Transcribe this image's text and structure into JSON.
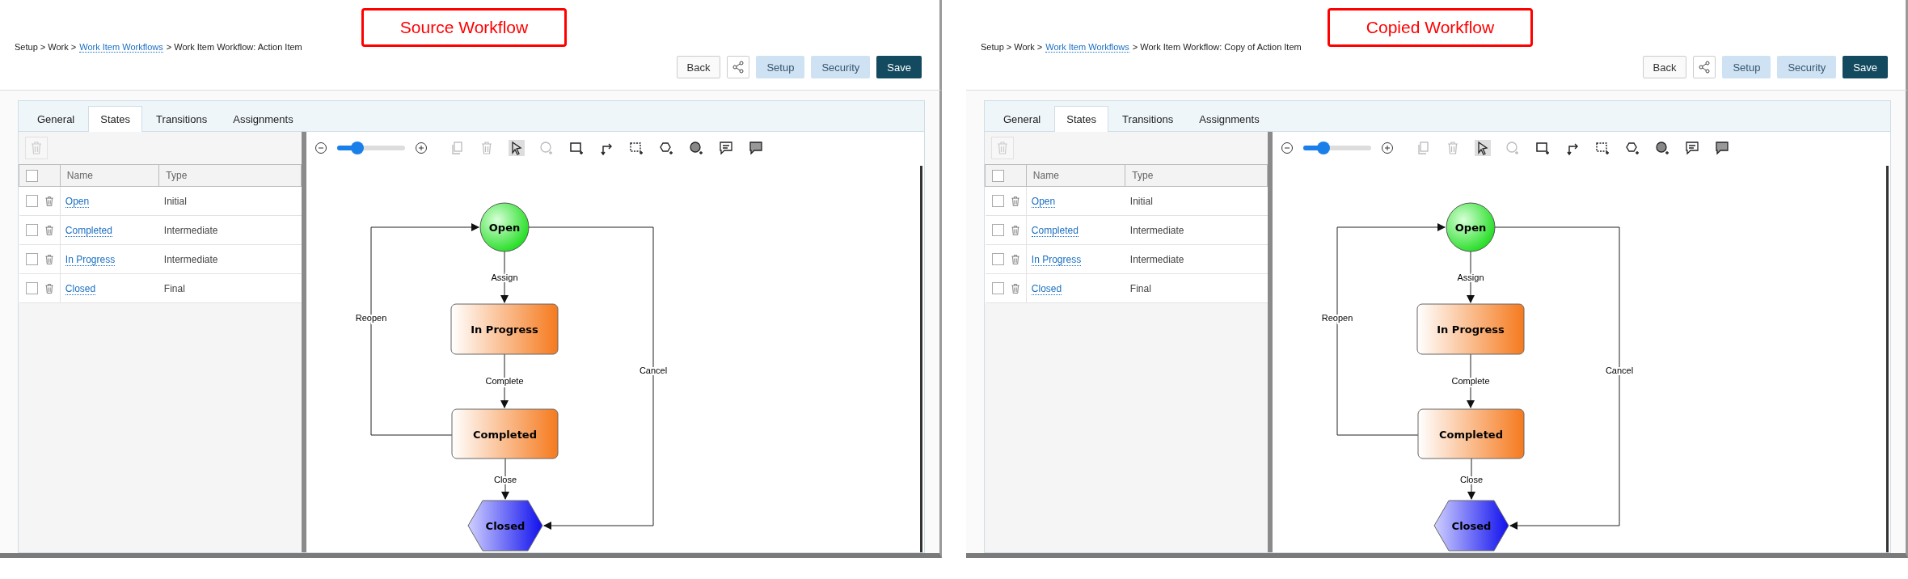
{
  "panels": [
    {
      "callout": "Source Workflow",
      "breadcrumb": [
        {
          "text": "Setup > Work >",
          "link": false
        },
        {
          "text": "Work Item Workflows",
          "link": true
        },
        {
          "text": "> Work Item Workflow: Action Item",
          "link": false
        }
      ],
      "buttons": [
        {
          "kind": "default",
          "label": "Back"
        },
        {
          "kind": "share"
        },
        {
          "kind": "secondary",
          "label": "Setup"
        },
        {
          "kind": "secondary",
          "label": "Security"
        },
        {
          "kind": "primary",
          "label": "Save"
        }
      ],
      "tabs": [
        {
          "label": "General",
          "selected": false
        },
        {
          "label": "States",
          "selected": true
        },
        {
          "label": "Transitions",
          "selected": false
        },
        {
          "label": "Assignments",
          "selected": false
        }
      ],
      "table": {
        "select_all_checked": false,
        "columns": [
          "Name",
          "Type"
        ],
        "rows": [
          {
            "name": "Open",
            "type": "Initial",
            "checked": false
          },
          {
            "name": "Completed",
            "type": "Intermediate",
            "checked": false
          },
          {
            "name": "In Progress",
            "type": "Intermediate",
            "checked": false
          },
          {
            "name": "Closed",
            "type": "Final",
            "checked": false
          }
        ]
      },
      "zoom": {
        "level": 0.3
      },
      "toolbar": [
        {
          "kind": "copy",
          "disabled": true,
          "selected": false
        },
        {
          "kind": "delete",
          "disabled": true,
          "selected": false
        },
        {
          "kind": "pointer",
          "disabled": false,
          "selected": true
        },
        {
          "kind": "add-circle",
          "disabled": true,
          "selected": false
        },
        {
          "kind": "add-rect",
          "disabled": false,
          "selected": false
        },
        {
          "kind": "connector",
          "disabled": false,
          "selected": false
        },
        {
          "kind": "add-dashed-rect",
          "disabled": false,
          "selected": false
        },
        {
          "kind": "add-hexagon",
          "disabled": false,
          "selected": false
        },
        {
          "kind": "add-filled-circle",
          "disabled": false,
          "selected": false
        },
        {
          "kind": "comment",
          "disabled": false,
          "selected": false
        },
        {
          "kind": "filled-comment",
          "disabled": false,
          "selected": false
        }
      ],
      "diagram": {
        "nodes": [
          {
            "label": "Open",
            "kind": "initial"
          },
          {
            "label": "In Progress",
            "kind": "intermediate"
          },
          {
            "label": "Completed",
            "kind": "intermediate"
          },
          {
            "label": "Closed",
            "kind": "final"
          }
        ],
        "edges": [
          {
            "label": "Assign"
          },
          {
            "label": "Complete"
          },
          {
            "label": "Close"
          },
          {
            "label": "Reopen"
          },
          {
            "label": "Cancel"
          }
        ]
      }
    },
    {
      "callout": "Copied Workflow",
      "breadcrumb": [
        {
          "text": "Setup > Work >",
          "link": false
        },
        {
          "text": "Work Item Workflows",
          "link": true
        },
        {
          "text": "> Work Item Workflow: Copy of Action Item",
          "link": false
        }
      ],
      "buttons": [
        {
          "kind": "default",
          "label": "Back"
        },
        {
          "kind": "share"
        },
        {
          "kind": "secondary",
          "label": "Setup"
        },
        {
          "kind": "secondary",
          "label": "Security"
        },
        {
          "kind": "primary",
          "label": "Save"
        }
      ],
      "tabs": [
        {
          "label": "General",
          "selected": false
        },
        {
          "label": "States",
          "selected": true
        },
        {
          "label": "Transitions",
          "selected": false
        },
        {
          "label": "Assignments",
          "selected": false
        }
      ],
      "table": {
        "select_all_checked": false,
        "columns": [
          "Name",
          "Type"
        ],
        "rows": [
          {
            "name": "Open",
            "type": "Initial",
            "checked": false
          },
          {
            "name": "Completed",
            "type": "Intermediate",
            "checked": false
          },
          {
            "name": "In Progress",
            "type": "Intermediate",
            "checked": false
          },
          {
            "name": "Closed",
            "type": "Final",
            "checked": false
          }
        ]
      },
      "zoom": {
        "level": 0.3
      },
      "toolbar": [
        {
          "kind": "copy",
          "disabled": true,
          "selected": false
        },
        {
          "kind": "delete",
          "disabled": true,
          "selected": false
        },
        {
          "kind": "pointer",
          "disabled": false,
          "selected": true
        },
        {
          "kind": "add-circle",
          "disabled": true,
          "selected": false
        },
        {
          "kind": "add-rect",
          "disabled": false,
          "selected": false
        },
        {
          "kind": "connector",
          "disabled": false,
          "selected": false
        },
        {
          "kind": "add-dashed-rect",
          "disabled": false,
          "selected": false
        },
        {
          "kind": "add-hexagon",
          "disabled": false,
          "selected": false
        },
        {
          "kind": "add-filled-circle",
          "disabled": false,
          "selected": false
        },
        {
          "kind": "comment",
          "disabled": false,
          "selected": false
        },
        {
          "kind": "filled-comment",
          "disabled": false,
          "selected": false
        }
      ],
      "diagram": {
        "nodes": [
          {
            "label": "Open",
            "kind": "initial"
          },
          {
            "label": "In Progress",
            "kind": "intermediate"
          },
          {
            "label": "Completed",
            "kind": "intermediate"
          },
          {
            "label": "Closed",
            "kind": "final"
          }
        ],
        "edges": [
          {
            "label": "Assign"
          },
          {
            "label": "Complete"
          },
          {
            "label": "Close"
          },
          {
            "label": "Reopen"
          },
          {
            "label": "Cancel"
          }
        ]
      }
    }
  ]
}
